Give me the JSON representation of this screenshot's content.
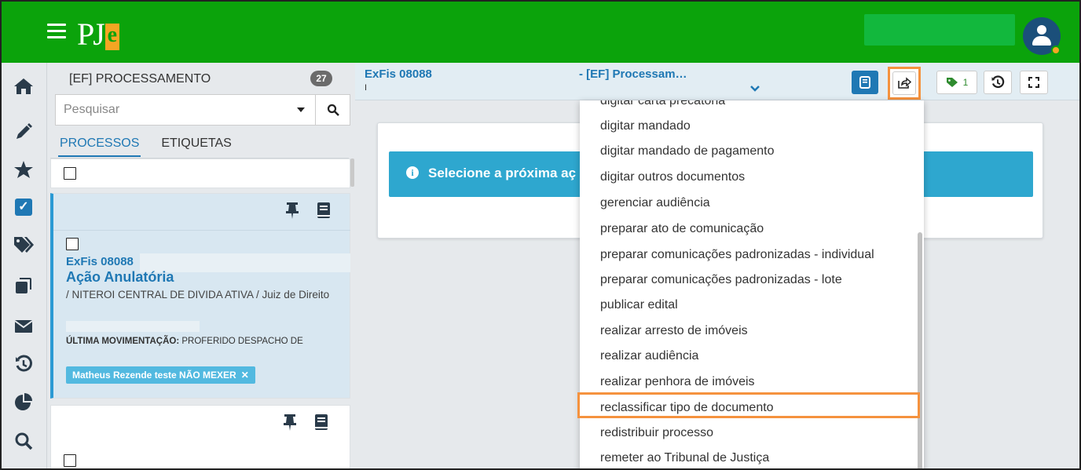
{
  "app": {
    "logo_text": "PJ",
    "logo_accent": "e",
    "colors": {
      "header": "#0ba30b",
      "accent": "#1f78b4",
      "info": "#2ea7cf",
      "highlight": "#f5923e",
      "tag": "#52b9e0"
    }
  },
  "rail": {
    "icons": [
      "home-icon",
      "pencil-icon",
      "star-icon",
      "checkbox-icon",
      "tags-icon",
      "copy-icon",
      "envelope-icon",
      "history-icon",
      "pie-chart-icon",
      "search-icon"
    ]
  },
  "panel": {
    "title": "[EF] PROCESSAMENTO",
    "count": "27",
    "search_placeholder": "Pesquisar",
    "tabs": [
      {
        "label": "PROCESSOS",
        "active": true
      },
      {
        "label": "ETIQUETAS",
        "active": false
      }
    ],
    "card": {
      "number": "ExFis 08088",
      "class": "Ação Anulatória",
      "location": "/ NITEROI CENTRAL DE DIVIDA ATIVA / Juiz de Direito",
      "movement_label": "ÚLTIMA MOVIMENTAÇÃO:",
      "movement_value": "PROFERIDO DESPACHO DE",
      "tag": "Matheus Rezende teste NÃO MEXER",
      "tag_remove": "✕"
    }
  },
  "main": {
    "tab_title_left": "ExFis 08088",
    "tab_title_right": "- [EF] Processam…",
    "tab_sub": "I",
    "tags_count": "1",
    "info_message": "Selecione a próxima aç"
  },
  "dropdown": {
    "items": [
      "digitar carta precatória",
      "digitar mandado",
      "digitar mandado de pagamento",
      "digitar outros documentos",
      "gerenciar audiência",
      "preparar ato de comunicação",
      "preparar comunicações padronizadas - individual",
      "preparar comunicações padronizadas - lote",
      "publicar edital",
      "realizar arresto de imóveis",
      "realizar audiência",
      "realizar penhora de imóveis",
      "reclassificar tipo de documento",
      "redistribuir processo",
      "remeter ao Tribunal de Justiça"
    ],
    "highlighted_item": "reclassificar tipo de documento"
  }
}
